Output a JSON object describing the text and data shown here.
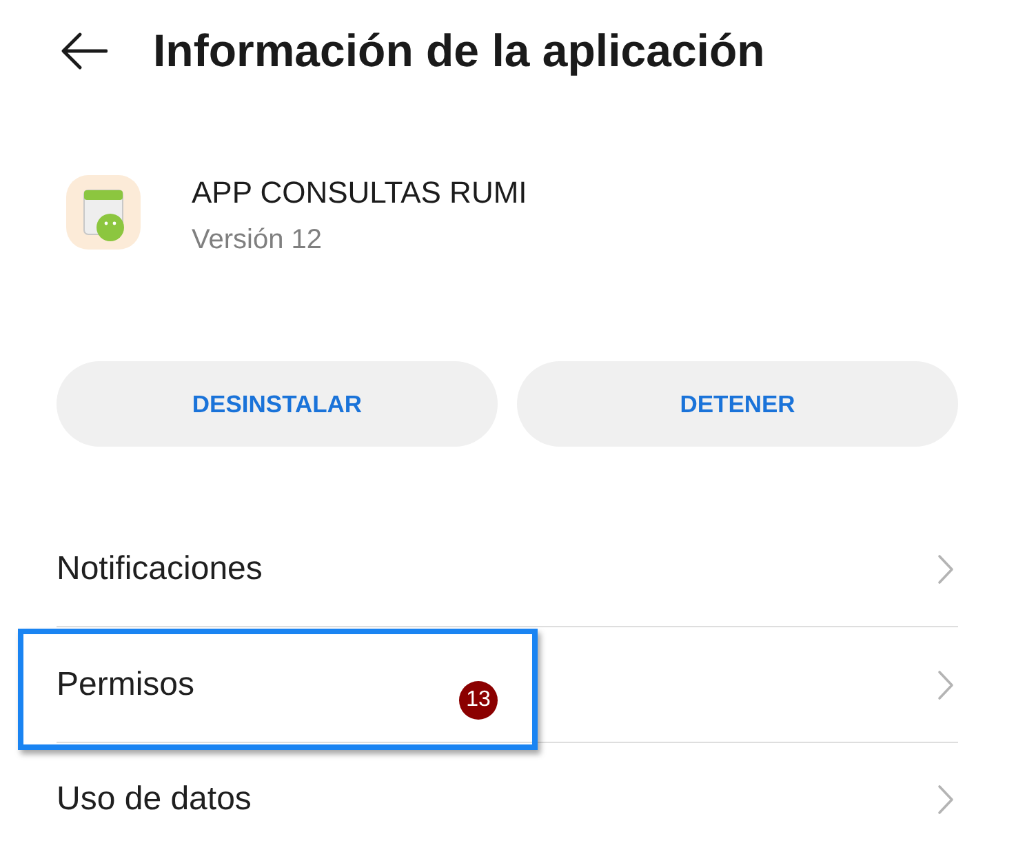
{
  "header": {
    "title": "Información de la aplicación"
  },
  "app": {
    "name": "APP CONSULTAS RUMI",
    "version": "Versión 12"
  },
  "buttons": [
    {
      "label": "DESINSTALAR"
    },
    {
      "label": "DETENER"
    }
  ],
  "settings": [
    {
      "label": "Notificaciones",
      "highlighted": false
    },
    {
      "label": "Permisos",
      "highlighted": true,
      "step_badge": "13"
    },
    {
      "label": "Uso de datos",
      "highlighted": false
    }
  ]
}
